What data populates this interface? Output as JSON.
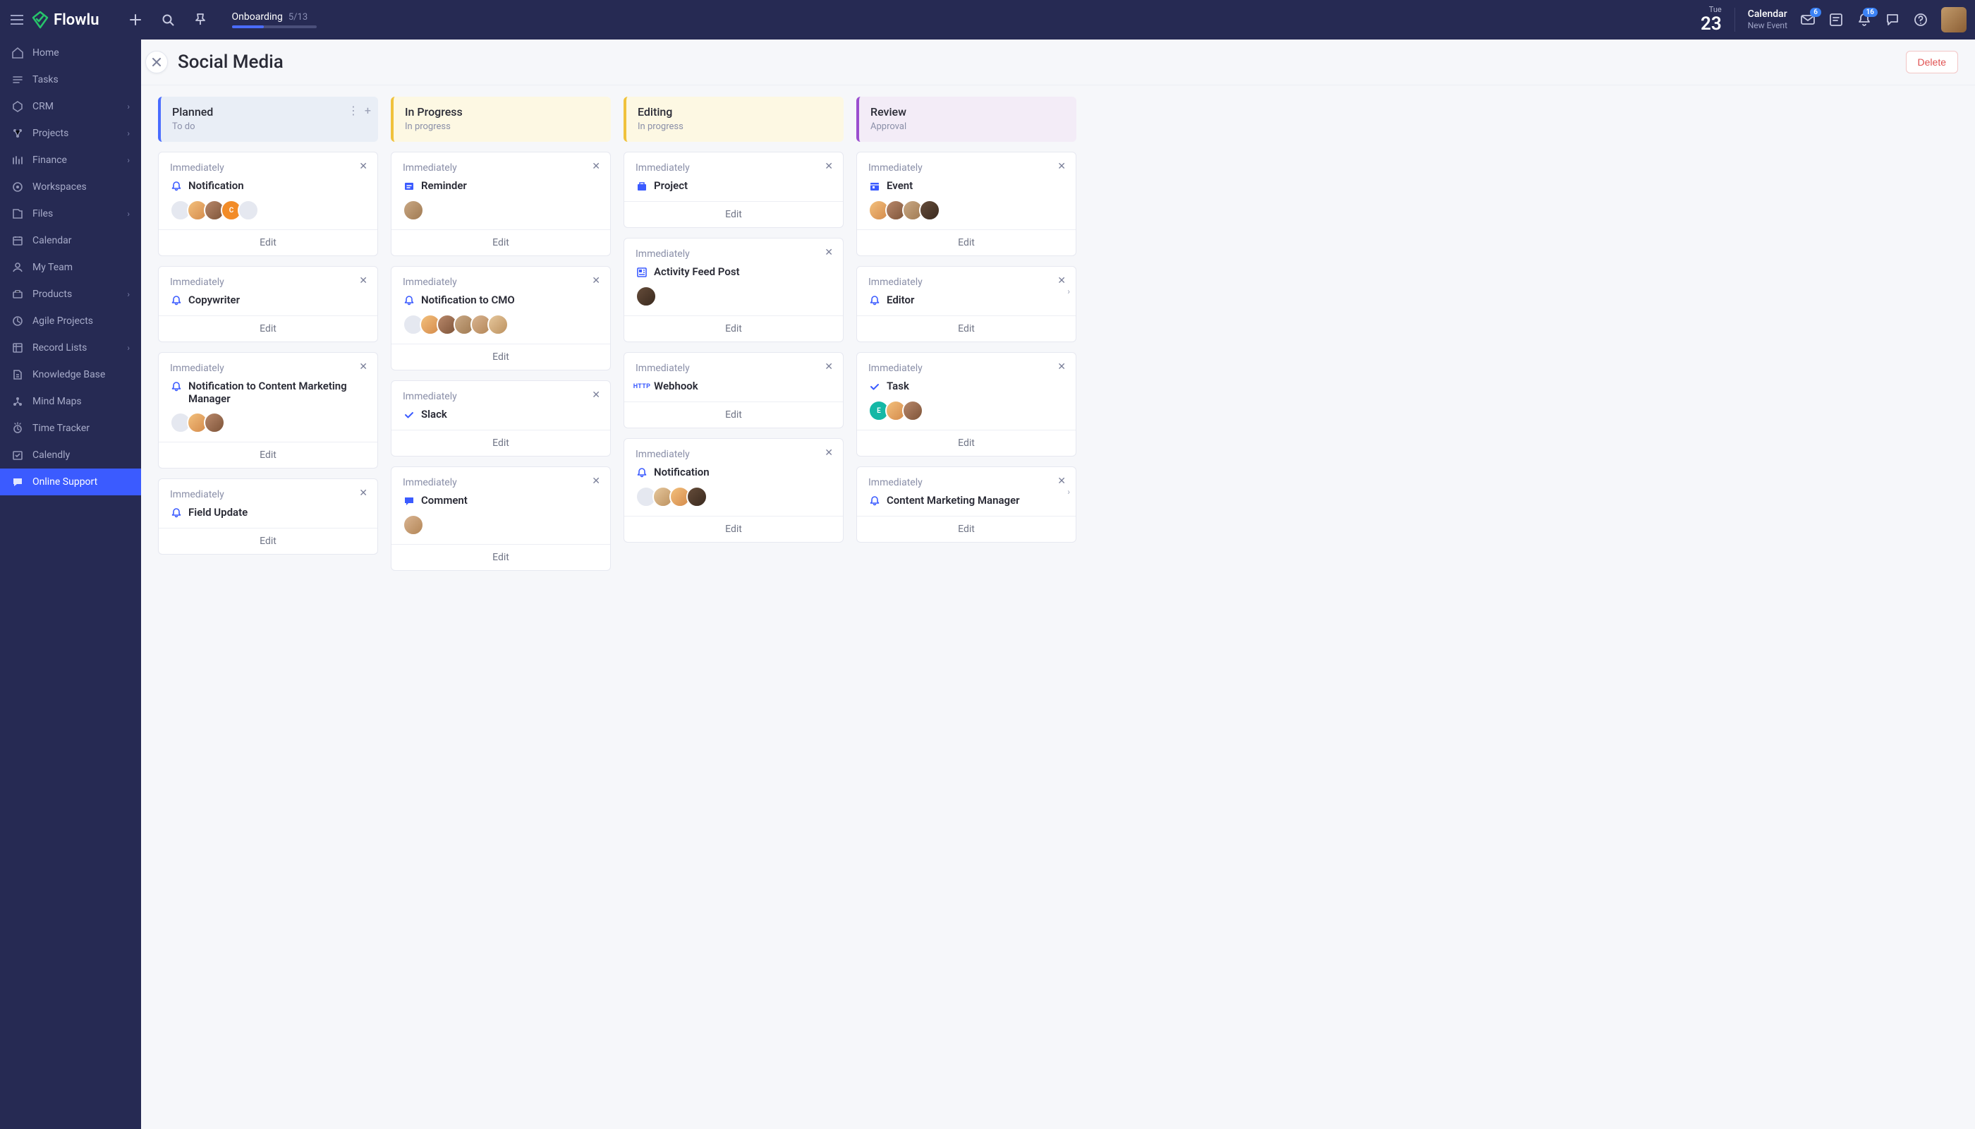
{
  "app": {
    "name": "Flowlu"
  },
  "topbar": {
    "onboarding": {
      "label": "Onboarding",
      "progress": "5/13"
    },
    "date": {
      "dow": "Tue",
      "day": "23"
    },
    "calendar": {
      "title": "Calendar",
      "subtitle": "New Event"
    },
    "mail_badge": "6",
    "bell_badge": "16"
  },
  "sidebar": {
    "items": [
      {
        "label": "Home",
        "chev": false
      },
      {
        "label": "Tasks",
        "chev": false
      },
      {
        "label": "CRM",
        "chev": true
      },
      {
        "label": "Projects",
        "chev": true
      },
      {
        "label": "Finance",
        "chev": true
      },
      {
        "label": "Workspaces",
        "chev": false
      },
      {
        "label": "Files",
        "chev": true
      },
      {
        "label": "Calendar",
        "chev": false
      },
      {
        "label": "My Team",
        "chev": false
      },
      {
        "label": "Products",
        "chev": true
      },
      {
        "label": "Agile Projects",
        "chev": false
      },
      {
        "label": "Record Lists",
        "chev": true
      },
      {
        "label": "Knowledge Base",
        "chev": false
      },
      {
        "label": "Mind Maps",
        "chev": false
      },
      {
        "label": "Time Tracker",
        "chev": false
      },
      {
        "label": "Calendly",
        "chev": false
      },
      {
        "label": "Online Support",
        "chev": false,
        "active": true
      }
    ]
  },
  "page": {
    "title": "Social Media",
    "delete": "Delete"
  },
  "board": {
    "edit_label": "Edit",
    "trigger_label": "Immediately",
    "columns": [
      {
        "title": "Planned",
        "subtitle": "To do",
        "style": "col-blue",
        "show_ctrls": true,
        "cards": [
          {
            "icon": "bell",
            "title": "Notification",
            "members": [
              "gray",
              "p1",
              "p2",
              "orange:C",
              "gray"
            ]
          },
          {
            "icon": "bell",
            "title": "Copywriter"
          },
          {
            "icon": "bell",
            "title": "Notification to Content Marketing Manager",
            "members": [
              "gray",
              "p1",
              "p2"
            ]
          },
          {
            "icon": "bell",
            "title": "Field Update"
          }
        ]
      },
      {
        "title": "In Progress",
        "subtitle": "In progress",
        "style": "col-yellow",
        "cards": [
          {
            "icon": "reminder",
            "title": "Reminder",
            "members": [
              "p3"
            ]
          },
          {
            "icon": "bell",
            "title": "Notification to CMO",
            "members": [
              "gray",
              "p1",
              "p2",
              "p3",
              "p5",
              "p6"
            ]
          },
          {
            "icon": "check",
            "title": "Slack"
          },
          {
            "icon": "comment",
            "title": "Comment",
            "members": [
              "p5"
            ]
          }
        ]
      },
      {
        "title": "Editing",
        "subtitle": "In progress",
        "style": "col-yellow2",
        "cards": [
          {
            "icon": "project",
            "title": "Project"
          },
          {
            "icon": "feed",
            "title": "Activity Feed Post",
            "members": [
              "p4"
            ]
          },
          {
            "icon": "http",
            "title": "Webhook"
          },
          {
            "icon": "bell",
            "title": "Notification",
            "members": [
              "gray",
              "p6",
              "p1",
              "p4"
            ]
          }
        ]
      },
      {
        "title": "Review",
        "subtitle": "Approval",
        "style": "col-purple",
        "cards": [
          {
            "icon": "event",
            "title": "Event",
            "members": [
              "p1",
              "p2",
              "p3",
              "p4"
            ]
          },
          {
            "icon": "bell",
            "title": "Editor",
            "chev": true
          },
          {
            "icon": "check",
            "title": "Task",
            "members": [
              "teal:E",
              "p1",
              "p2"
            ]
          },
          {
            "icon": "bell",
            "title": "Content Marketing Manager",
            "chev": true
          }
        ]
      }
    ]
  }
}
